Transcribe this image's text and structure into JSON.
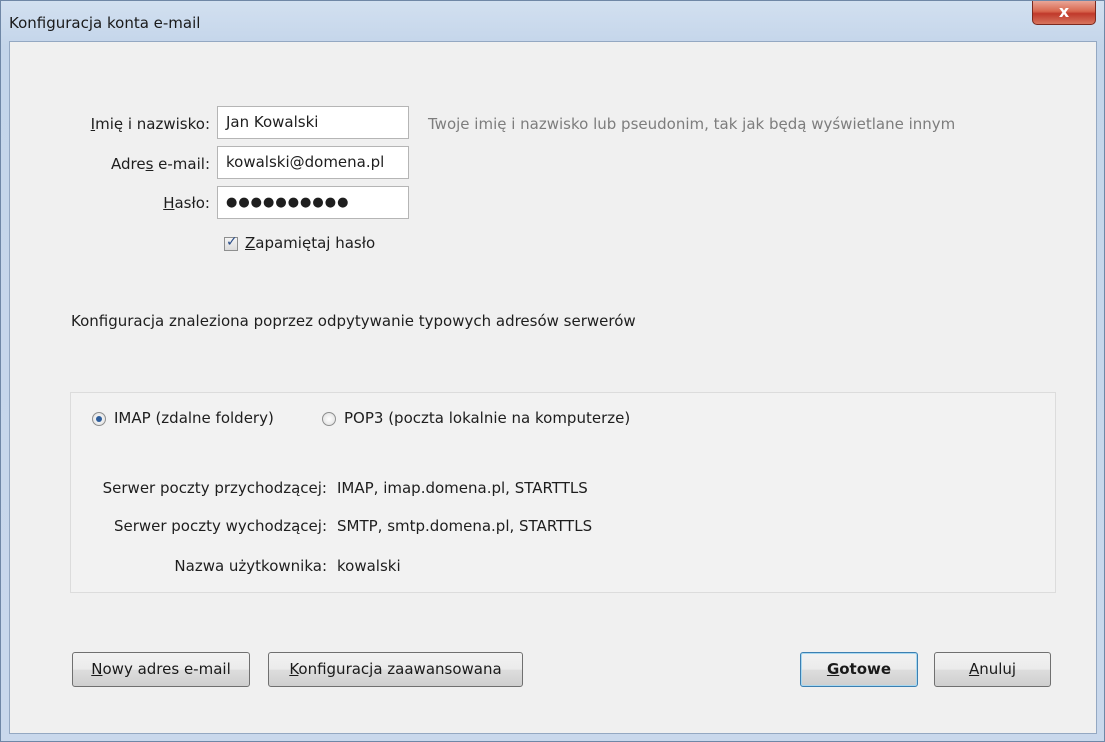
{
  "window": {
    "title": "Konfiguracja konta e-mail",
    "close_glyph": "x"
  },
  "form": {
    "name": {
      "label_access": "I",
      "label_rest": "mię i nazwisko:",
      "value": "Jan Kowalski",
      "hint": "Twoje imię i nazwisko lub pseudonim, tak jak będą wyświetlane innym"
    },
    "email": {
      "label_pre": "Adre",
      "label_access": "s",
      "label_rest": " e-mail:",
      "value": "kowalski@domena.pl"
    },
    "password": {
      "label_access": "H",
      "label_rest": "asło:",
      "value": "●●●●●●●●●●"
    },
    "remember": {
      "checked": true,
      "label_access": "Z",
      "label_rest": "apamiętaj hasło"
    }
  },
  "status_text": "Konfiguracja znaleziona poprzez odpytywanie typowych adresów serwerów",
  "server": {
    "protocols": [
      {
        "label": "IMAP (zdalne foldery)",
        "selected": true
      },
      {
        "label": "POP3 (poczta lokalnie na komputerze)",
        "selected": false
      }
    ],
    "rows": [
      {
        "label": "Serwer poczty przychodzącej:",
        "value": "IMAP, imap.domena.pl, STARTTLS"
      },
      {
        "label": "Serwer poczty wychodzącej:",
        "value": "SMTP, smtp.domena.pl, STARTTLS"
      },
      {
        "label": "Nazwa użytkownika:",
        "value": "kowalski"
      }
    ]
  },
  "buttons": {
    "new_email": {
      "access": "N",
      "rest": "owy adres e-mail"
    },
    "advanced": {
      "access": "K",
      "rest": "onfiguracja zaawansowana"
    },
    "done": {
      "access": "G",
      "rest": "otowe"
    },
    "cancel": {
      "access": "A",
      "rest": "nuluj"
    }
  },
  "colors": {
    "close_button": "#c0392b",
    "default_button_border": "#3c7fb1",
    "radio_dot": "#2d5d9b"
  }
}
